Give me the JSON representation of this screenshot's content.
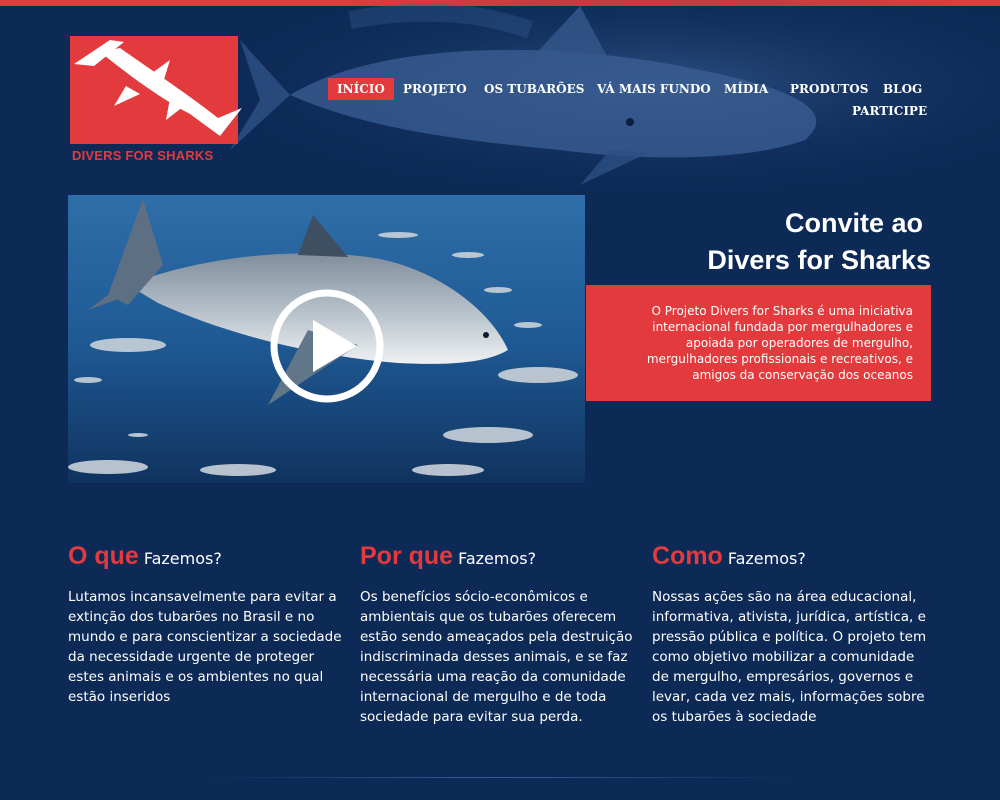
{
  "brand": {
    "logo_text": "DIVERS FOR SHARKS"
  },
  "colors": {
    "accent": "#e33a3d",
    "background": "#0d2a57"
  },
  "nav": {
    "items": [
      {
        "label": "INÍCIO",
        "active": true
      },
      {
        "label": "PROJETO"
      },
      {
        "label": "OS TUBARÕES"
      },
      {
        "label": "VÁ MAIS FUNDO"
      },
      {
        "label": "MÍDIA"
      },
      {
        "label": "PRODUTOS"
      },
      {
        "label": "BLOG"
      },
      {
        "label": "PARTICIPE"
      }
    ]
  },
  "hero": {
    "title_line1": "Convite ao",
    "title_line2": "Divers for Sharks",
    "intro": "O Projeto Divers for Sharks é uma iniciativa internacional fundada por mergulhadores e apoiada por operadores de mergulho, mergulhadores profissionais e recreativos, e amigos da conservação dos oceanos",
    "video_icon": "play-icon"
  },
  "columns": [
    {
      "title_big": "O que",
      "title_small": "Fazemos?",
      "text": "Lutamos incansavelmente para evitar a extinção dos tubarões no Brasil e no mundo e para conscientizar a sociedade da necessidade urgente de proteger estes animais e os ambientes no qual estão inseridos"
    },
    {
      "title_big": "Por que",
      "title_small": "Fazemos?",
      "text": "Os benefícios sócio-econômicos e ambientais que os tubarões oferecem estão sendo ameaçados pela destruição indiscriminada desses animais, e se faz necessária uma reação da comunidade internacional de mergulho e de toda sociedade para evitar sua perda."
    },
    {
      "title_big": "Como",
      "title_small": "Fazemos?",
      "text": "Nossas ações são na área educacional, informativa, ativista, jurídica, artística, e pressão pública e política. O projeto tem como objetivo mobilizar a comunidade de mergulho, empresários, governos e levar, cada vez mais, informações sobre os tubarões à sociedade"
    }
  ]
}
